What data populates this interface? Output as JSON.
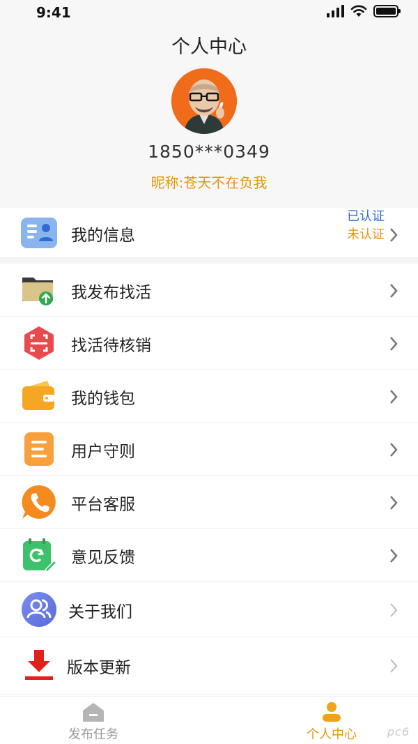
{
  "status_bar": {
    "time": "9:41"
  },
  "header": {
    "title": "个人中心",
    "phone": "1850***0349",
    "nickname": "昵称:苍天不在负我"
  },
  "menu": {
    "items": [
      {
        "label": "我的信息",
        "icon": "id-card-icon",
        "status_verified": "已认证",
        "status_unverified": "未认证"
      },
      {
        "label": "我发布找活",
        "icon": "folder-upload-icon"
      },
      {
        "label": "找活待核销",
        "icon": "scan-icon"
      },
      {
        "label": "我的钱包",
        "icon": "wallet-icon"
      },
      {
        "label": "用户守则",
        "icon": "document-icon"
      },
      {
        "label": "平台客服",
        "icon": "phone-icon"
      },
      {
        "label": "意见反馈",
        "icon": "feedback-icon"
      },
      {
        "label": "关于我们",
        "icon": "people-icon"
      },
      {
        "label": "版本更新",
        "icon": "download-icon"
      }
    ]
  },
  "tabbar": {
    "tabs": [
      {
        "label": "发布任务",
        "icon": "home-icon",
        "active": false
      },
      {
        "label": "个人中心",
        "icon": "user-icon",
        "active": true
      }
    ]
  },
  "watermark": "pc6",
  "colors": {
    "accent": "#e8950c",
    "verified": "#2f6bd0",
    "inactive": "#999999"
  }
}
